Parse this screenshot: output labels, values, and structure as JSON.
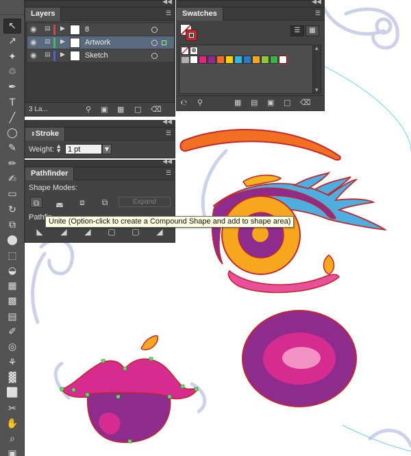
{
  "tools": [
    {
      "icon": "selection-arrow-icon",
      "glyph": "↖"
    },
    {
      "icon": "direct-selection-icon",
      "glyph": "↗"
    },
    {
      "icon": "magic-wand-icon",
      "glyph": "✦"
    },
    {
      "icon": "lasso-icon",
      "glyph": "♲"
    },
    {
      "icon": "pen-icon",
      "glyph": "✒"
    },
    {
      "icon": "type-icon",
      "glyph": "T"
    },
    {
      "icon": "line-segment-icon",
      "glyph": "╱"
    },
    {
      "icon": "ellipse-icon",
      "glyph": "◯"
    },
    {
      "icon": "paintbrush-icon",
      "glyph": "✎"
    },
    {
      "icon": "pencil-icon",
      "glyph": "✏"
    },
    {
      "icon": "blob-brush-icon",
      "glyph": "✍"
    },
    {
      "icon": "eraser-icon",
      "glyph": "▭"
    },
    {
      "icon": "rotate-icon",
      "glyph": "↻"
    },
    {
      "icon": "scale-icon",
      "glyph": "⧉"
    },
    {
      "icon": "width-icon",
      "glyph": "⬤"
    },
    {
      "icon": "free-transform-icon",
      "glyph": "⬚"
    },
    {
      "icon": "shape-builder-icon",
      "glyph": "◒"
    },
    {
      "icon": "perspective-grid-icon",
      "glyph": "▦"
    },
    {
      "icon": "mesh-icon",
      "glyph": "▩"
    },
    {
      "icon": "gradient-icon",
      "glyph": "▤"
    },
    {
      "icon": "eyedropper-icon",
      "glyph": "✐"
    },
    {
      "icon": "blend-icon",
      "glyph": "◎"
    },
    {
      "icon": "symbol-sprayer-icon",
      "glyph": "⚘"
    },
    {
      "icon": "column-graph-icon",
      "glyph": "▓"
    },
    {
      "icon": "artboard-icon",
      "glyph": "⬜"
    },
    {
      "icon": "slice-icon",
      "glyph": "✂"
    },
    {
      "icon": "hand-icon",
      "glyph": "✋"
    },
    {
      "icon": "zoom-icon",
      "glyph": "⌕"
    },
    {
      "icon": "fill-stroke-icon",
      "glyph": "▣"
    }
  ],
  "layers": {
    "tab": "Layers",
    "rows": [
      {
        "name": "8",
        "color": "#c94b4b"
      },
      {
        "name": "Artwork",
        "color": "#3fbf5a"
      },
      {
        "name": "Sketch",
        "color": "#4a64d8"
      }
    ],
    "count_label": "3 La..."
  },
  "swatches": {
    "tab": "Swatches",
    "colors": [
      "#ffffff",
      "#e7237f",
      "#8e2c8e",
      "#f36f21",
      "#ffd200",
      "#35b5e5",
      "#2c7bc9",
      "#f7a71d",
      "#8dc63f",
      "#3ab54a",
      "#ffffff"
    ]
  },
  "stroke": {
    "tab": "Stroke",
    "weight_label": "Weight:",
    "weight_value": "1 pt"
  },
  "pathfinder": {
    "tab": "Pathfinder",
    "shape_modes_label": "Shape Modes:",
    "pathfinders_label": "Pathfin",
    "expand_label": "Expand"
  },
  "tooltip": "Unite (Option-click to create a Compound Shape and add to shape area)"
}
